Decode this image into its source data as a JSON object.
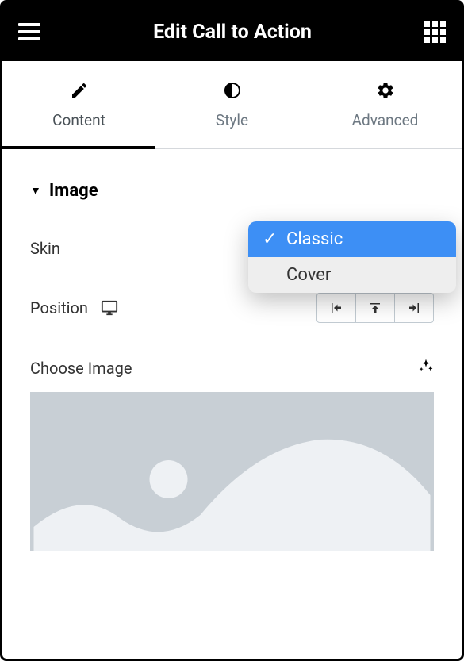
{
  "header": {
    "title": "Edit Call to Action"
  },
  "tabs": {
    "content": "Content",
    "style": "Style",
    "advanced": "Advanced"
  },
  "section": {
    "title": "Image"
  },
  "controls": {
    "skin_label": "Skin",
    "position_label": "Position",
    "choose_image_label": "Choose Image"
  },
  "dropdown": {
    "options": [
      {
        "label": "Classic",
        "selected": true
      },
      {
        "label": "Cover",
        "selected": false
      }
    ]
  }
}
